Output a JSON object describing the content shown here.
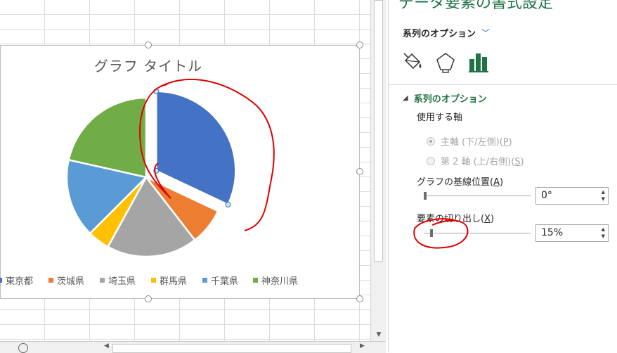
{
  "chart": {
    "title": "グラフ タイトル",
    "legend": [
      {
        "name": "東京都",
        "color": "#4472C4"
      },
      {
        "name": "茨城県",
        "color": "#ED7D31"
      },
      {
        "name": "埼玉県",
        "color": "#A5A5A5"
      },
      {
        "name": "群馬県",
        "color": "#FFC000"
      },
      {
        "name": "千葉県",
        "color": "#5B9BD5"
      },
      {
        "name": "神奈川県",
        "color": "#70AD47"
      }
    ]
  },
  "chart_data": {
    "type": "pie",
    "title": "グラフ タイトル",
    "categories": [
      "東京都",
      "茨城県",
      "埼玉県",
      "群馬県",
      "千葉県",
      "神奈川県"
    ],
    "values": [
      32.0,
      7.5,
      18.5,
      4.5,
      16.0,
      21.5
    ],
    "exploded": [
      "東京都"
    ],
    "legend_position": "bottom"
  },
  "panel": {
    "title": "データ要素の書式設定",
    "options_dropdown": "系列のオプション",
    "tabs": [
      "fill-line",
      "effects",
      "series-options"
    ],
    "section_header": "系列のオプション",
    "axis_label": "使用する軸",
    "radio_primary": "主軸 (下/左側)(",
    "radio_primary_key": "P",
    "radio_secondary": "第 2 軸 (上/右側)(",
    "radio_secondary_key": "S",
    "radio_suffix": ")",
    "angle_label": "グラフの基線位置(",
    "angle_key": "A",
    "angle_value": "0°",
    "angle_fraction": 0.0,
    "explosion_label": "要素の切り出し(",
    "explosion_key": "X",
    "explosion_value": "15%",
    "explosion_fraction": 0.15
  },
  "colors": {
    "accent": "#217346",
    "annotation": "#E00000"
  }
}
